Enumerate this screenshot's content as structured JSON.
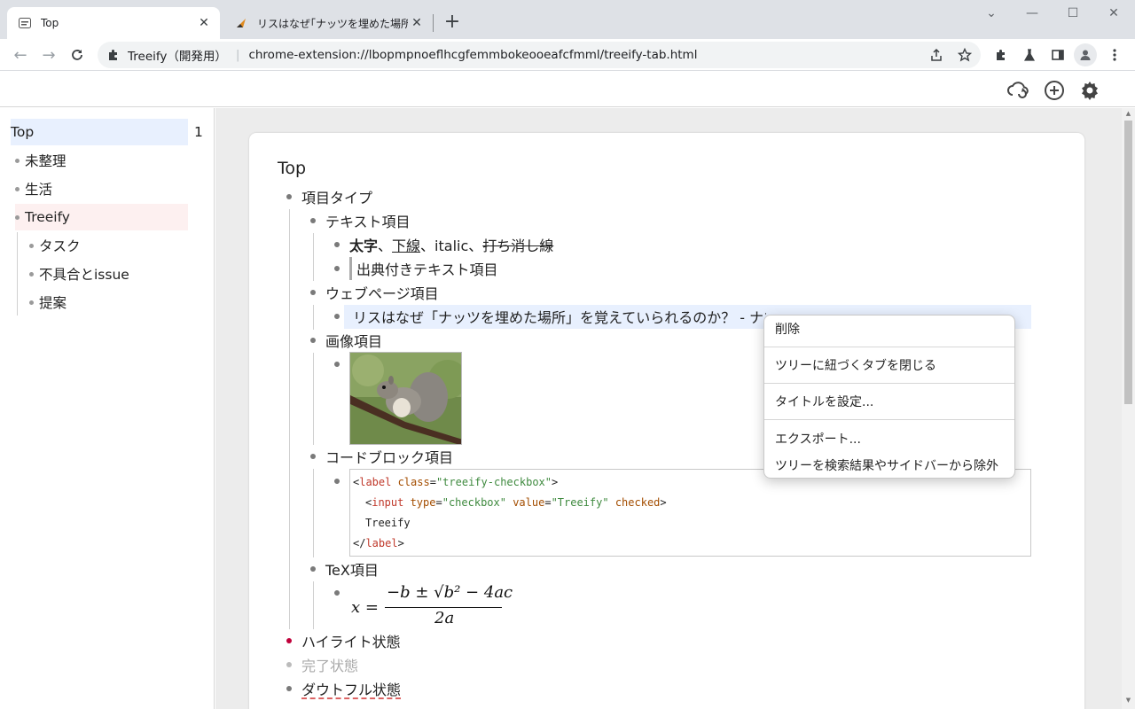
{
  "browser": {
    "tabs": [
      {
        "title": "Top",
        "active": true
      },
      {
        "title": "リスはなぜ｢ナッツを埋めた場所｣を覚",
        "active": false
      }
    ],
    "omnibox": {
      "extension_name": "Treeify（開発用）",
      "url": "chrome-extension://lbopmpnoeflhcgfemmbokeooeafcfmml/treeify-tab.html"
    }
  },
  "sidebar": {
    "items": [
      {
        "label": "Top",
        "count": "1",
        "selected": true
      },
      {
        "label": "未整理"
      },
      {
        "label": "生活"
      },
      {
        "label": "Treeify",
        "highlighted": true
      },
      {
        "label": "タスク"
      },
      {
        "label": "不具合とissue"
      },
      {
        "label": "提案"
      }
    ]
  },
  "main": {
    "page_title": "Top",
    "items": {
      "item_types": "項目タイプ",
      "text_item": "テキスト項目",
      "bold": "太字",
      "sep1": "、",
      "underline": "下線",
      "sep2": "、italic、",
      "strike": "打ち消し線",
      "cited_text": "出典付きテキスト項目",
      "webpage_item": "ウェブページ項目",
      "webpage_title": "リスはなぜ「ナッツを埋めた場所」を覚えていられるのか？ - ナゾロジ",
      "image_item": "画像項目",
      "codeblock_item": "コードブロック項目",
      "tex_item": "TeX項目",
      "highlight_state": "ハイライト状態",
      "completed_state": "完了状態",
      "doubtful_state": "ダウトフル状態"
    },
    "code": {
      "l1_open": "<",
      "l1_tag": "label",
      "l1_attr": " class",
      "l1_eq": "=",
      "l1_str": "\"treeify-checkbox\"",
      "l1_close": ">",
      "l2_open": "<",
      "l2_tag": "input",
      "l2_attr1": " type",
      "l2_eq1": "=",
      "l2_str1": "\"checkbox\"",
      "l2_attr2": " value",
      "l2_eq2": "=",
      "l2_str2": "\"Treeify\"",
      "l2_attr3": " checked",
      "l2_close": ">",
      "l3_text": "Treeify",
      "l4_open": "</",
      "l4_tag": "label",
      "l4_close": ">"
    },
    "tex": {
      "lhs": "x =",
      "numerator": "−b ± √b² − 4ac",
      "denominator": "2a"
    }
  },
  "context_menu": {
    "delete": "削除",
    "close_tabs": "ツリーに紐づくタブを閉じる",
    "set_title": "タイトルを設定...",
    "export": "エクスポート...",
    "exclude": "ツリーを検索結果やサイドバーから除外"
  },
  "colors": {
    "highlight_bullet": "#c0003a",
    "completed_text": "#aaaaaa",
    "doubtful_underline": "#d03030",
    "sidebar_selected_bg": "#e8f0fe",
    "sidebar_treeify_bg": "#fdf0f0"
  }
}
